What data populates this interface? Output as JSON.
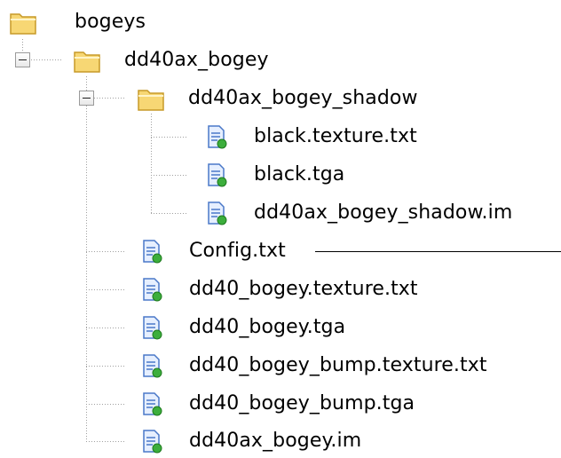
{
  "tree": {
    "root": {
      "label": "bogeys",
      "icon": "folder-icon"
    },
    "level1": {
      "label": "dd40ax_bogey",
      "icon": "folder-icon",
      "state": "expanded"
    },
    "level2": {
      "label": "dd40ax_bogey_shadow",
      "icon": "folder-icon",
      "state": "expanded"
    },
    "shadow_files": [
      {
        "label": "black.texture.txt",
        "icon": "file-icon"
      },
      {
        "label": "black.tga",
        "icon": "file-icon"
      },
      {
        "label": "dd40ax_bogey_shadow.im",
        "icon": "file-icon"
      }
    ],
    "bogey_files": [
      {
        "label": "Config.txt",
        "icon": "file-icon"
      },
      {
        "label": "dd40_bogey.texture.txt",
        "icon": "file-icon"
      },
      {
        "label": "dd40_bogey.tga",
        "icon": "file-icon"
      },
      {
        "label": "dd40_bogey_bump.texture.txt",
        "icon": "file-icon"
      },
      {
        "label": "dd40_bogey_bump.tga",
        "icon": "file-icon"
      },
      {
        "label": "dd40ax_bogey.im",
        "icon": "file-icon"
      }
    ]
  },
  "colors": {
    "folder_fill": "#f7d774",
    "folder_edge": "#c79a28",
    "file_blue": "#4a78c8",
    "file_green": "#3cae3c",
    "guide": "#a0a0a0"
  }
}
